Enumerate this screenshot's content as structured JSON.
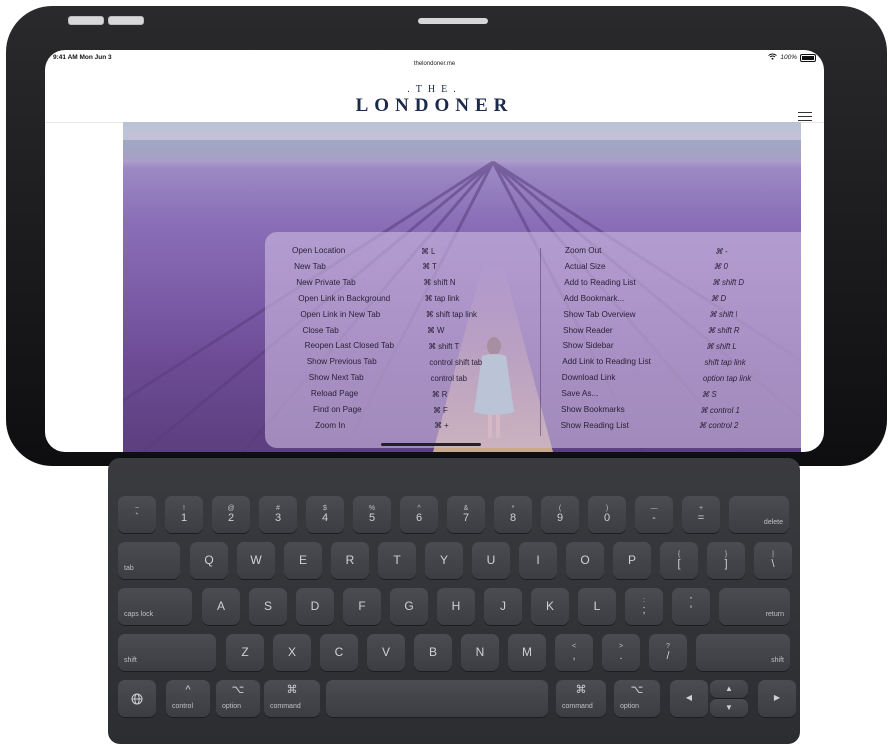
{
  "status_bar": {
    "time": "9:41 AM  Mon Jun 3",
    "url": "thelondoner.me",
    "battery": "100%"
  },
  "site": {
    "the": ".THE.",
    "title": "LONDONER",
    "menu_icon": "hamburger-icon"
  },
  "shortcuts": {
    "left": [
      {
        "name": "Open Location",
        "keys": "⌘ L"
      },
      {
        "name": "New Tab",
        "keys": "⌘ T"
      },
      {
        "name": "New Private Tab",
        "keys": "⌘ shift N"
      },
      {
        "name": "Open Link in Background",
        "keys": "⌘ tap link"
      },
      {
        "name": "Open Link in New Tab",
        "keys": "⌘ shift tap link"
      },
      {
        "name": "Close Tab",
        "keys": "⌘ W"
      },
      {
        "name": "Reopen Last Closed Tab",
        "keys": "⌘ shift T"
      },
      {
        "name": "Show Previous Tab",
        "keys": "control shift tab"
      },
      {
        "name": "Show Next Tab",
        "keys": "control tab"
      },
      {
        "name": "Reload Page",
        "keys": "⌘ R"
      },
      {
        "name": "Find on Page",
        "keys": "⌘ F"
      },
      {
        "name": "Zoom In",
        "keys": "⌘ +"
      }
    ],
    "right": [
      {
        "name": "Zoom Out",
        "keys": "⌘ -"
      },
      {
        "name": "Actual Size",
        "keys": "⌘ 0"
      },
      {
        "name": "Add to Reading List",
        "keys": "⌘ shift D"
      },
      {
        "name": "Add Bookmark...",
        "keys": "⌘ D"
      },
      {
        "name": "Show Tab Overview",
        "keys": "⌘ shift \\"
      },
      {
        "name": "Show Reader",
        "keys": "⌘ shift R"
      },
      {
        "name": "Show Sidebar",
        "keys": "⌘ shift L"
      },
      {
        "name": "Add Link to Reading List",
        "keys": "shift tap link"
      },
      {
        "name": "Download Link",
        "keys": "option tap link"
      },
      {
        "name": "Save As...",
        "keys": "⌘ S"
      },
      {
        "name": "Show Bookmarks",
        "keys": "⌘ control 1"
      },
      {
        "name": "Show Reading List",
        "keys": "⌘ control 2"
      }
    ]
  },
  "keyboard": {
    "row1": [
      {
        "top": "~",
        "bottom": "`"
      },
      {
        "top": "!",
        "bottom": "1"
      },
      {
        "top": "@",
        "bottom": "2"
      },
      {
        "top": "#",
        "bottom": "3"
      },
      {
        "top": "$",
        "bottom": "4"
      },
      {
        "top": "%",
        "bottom": "5"
      },
      {
        "top": "^",
        "bottom": "6"
      },
      {
        "top": "&",
        "bottom": "7"
      },
      {
        "top": "*",
        "bottom": "8"
      },
      {
        "top": "(",
        "bottom": "9"
      },
      {
        "top": ")",
        "bottom": "0"
      },
      {
        "top": "—",
        "bottom": "-"
      },
      {
        "top": "+",
        "bottom": "="
      }
    ],
    "delete": "delete",
    "tab": "tab",
    "row2": [
      "Q",
      "W",
      "E",
      "R",
      "T",
      "Y",
      "U",
      "I",
      "O",
      "P"
    ],
    "row2_sym": [
      {
        "top": "{",
        "bottom": "["
      },
      {
        "top": "}",
        "bottom": "]"
      },
      {
        "top": "|",
        "bottom": "\\"
      }
    ],
    "caps_lock": "caps lock",
    "row3": [
      "A",
      "S",
      "D",
      "F",
      "G",
      "H",
      "J",
      "K",
      "L"
    ],
    "row3_sym": [
      {
        "top": ":",
        "bottom": ";"
      },
      {
        "top": "\"",
        "bottom": "'"
      }
    ],
    "return": "return",
    "shift": "shift",
    "row4": [
      "Z",
      "X",
      "C",
      "V",
      "B",
      "N",
      "M"
    ],
    "row4_sym": [
      {
        "top": "<",
        "bottom": ","
      },
      {
        "top": ">",
        "bottom": "."
      },
      {
        "top": "?",
        "bottom": "/"
      }
    ],
    "bottom_row": {
      "globe_icon": "globe-icon",
      "control_sym": "^",
      "control": "control",
      "option_sym": "⌥",
      "option": "option",
      "command_sym": "⌘",
      "command": "command",
      "left_arrow": "◀",
      "up_arrow": "▲",
      "down_arrow": "▼",
      "right_arrow": "▶"
    }
  }
}
